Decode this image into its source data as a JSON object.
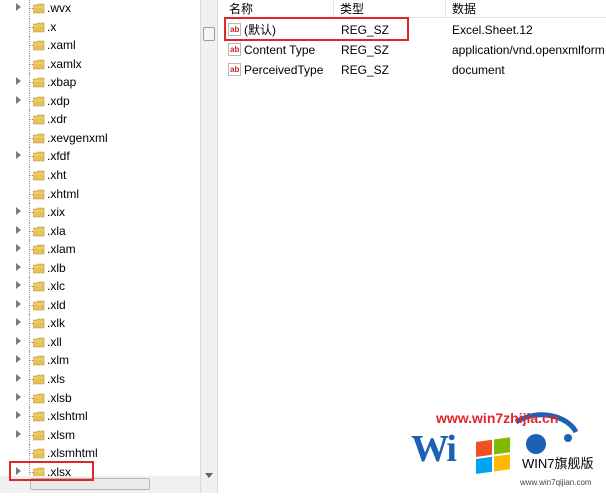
{
  "tree": {
    "items": [
      {
        "label": ".wvx",
        "expandable": true
      },
      {
        "label": ".x",
        "expandable": false
      },
      {
        "label": ".xaml",
        "expandable": false
      },
      {
        "label": ".xamlx",
        "expandable": false
      },
      {
        "label": ".xbap",
        "expandable": true
      },
      {
        "label": ".xdp",
        "expandable": true
      },
      {
        "label": ".xdr",
        "expandable": false
      },
      {
        "label": ".xevgenxml",
        "expandable": false
      },
      {
        "label": ".xfdf",
        "expandable": true
      },
      {
        "label": ".xht",
        "expandable": false
      },
      {
        "label": ".xhtml",
        "expandable": false
      },
      {
        "label": ".xix",
        "expandable": true
      },
      {
        "label": ".xla",
        "expandable": true
      },
      {
        "label": ".xlam",
        "expandable": true
      },
      {
        "label": ".xlb",
        "expandable": true
      },
      {
        "label": ".xlc",
        "expandable": true
      },
      {
        "label": ".xld",
        "expandable": true
      },
      {
        "label": ".xlk",
        "expandable": true
      },
      {
        "label": ".xll",
        "expandable": true
      },
      {
        "label": ".xlm",
        "expandable": true
      },
      {
        "label": ".xls",
        "expandable": true
      },
      {
        "label": ".xlsb",
        "expandable": true
      },
      {
        "label": ".xlshtml",
        "expandable": true
      },
      {
        "label": ".xlsm",
        "expandable": true
      },
      {
        "label": ".xlsmhtml",
        "expandable": false
      },
      {
        "label": ".xlsx",
        "expandable": true
      }
    ],
    "highlighted_item": ".xlsx"
  },
  "values": {
    "headers": {
      "name": "名称",
      "type": "类型",
      "data": "数据"
    },
    "rows": [
      {
        "name": "(默认)",
        "type": "REG_SZ",
        "data": "Excel.Sheet.12",
        "icon": "string-value-icon"
      },
      {
        "name": "Content Type",
        "type": "REG_SZ",
        "data": "application/vnd.openxmlform",
        "icon": "string-value-icon"
      },
      {
        "name": "PerceivedType",
        "type": "REG_SZ",
        "data": "document",
        "icon": "string-value-icon"
      }
    ],
    "icon_text": "ab"
  },
  "watermark": {
    "url": "www.win7zhijia.cn",
    "logo_text": "Wi",
    "brand": "WIN7旗舰版",
    "small_url": "www.win7qijian.com"
  },
  "colors": {
    "highlight_border": "#e0262b",
    "folder": "#e8c15a",
    "watermark_blue": "#1b61b5"
  }
}
